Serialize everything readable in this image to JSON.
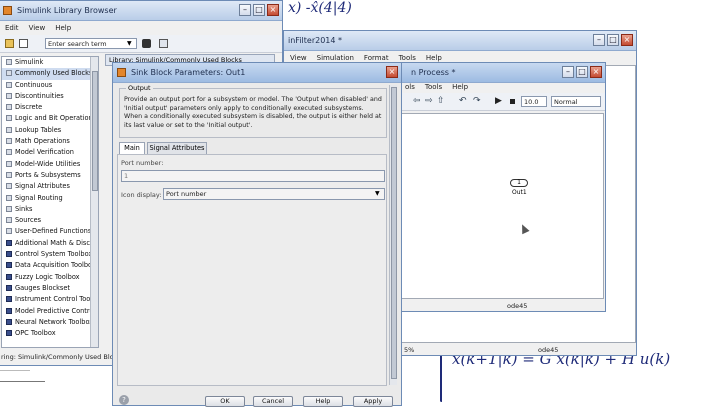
{
  "library": {
    "title": "Simulink Library Browser",
    "menu": [
      "Edit",
      "View",
      "Help"
    ],
    "search_placeholder": "Enter search term",
    "tab_label": "Library: Simulink/Commonly Used Blocks",
    "items": [
      "Simulink",
      "Commonly Used Blocks",
      "Continuous",
      "Discontinuities",
      "Discrete",
      "Logic and Bit Operations",
      "Lookup Tables",
      "Math Operations",
      "Model Verification",
      "Model-Wide Utilities",
      "Ports & Subsystems",
      "Signal Attributes",
      "Signal Routing",
      "Sinks",
      "Sources",
      "User-Defined Functions",
      "Additional Math & Discrete",
      "Control System Toolbox",
      "Data Acquisition Toolbox",
      "Fuzzy Logic Toolbox",
      "Gauges Blockset",
      "Instrument Control Toolbox",
      "Model Predictive Control ...",
      "Neural Network Toolbox",
      "OPC Toolbox"
    ],
    "status": "ring: Simulink/Commonly Used Blocks"
  },
  "model_back": {
    "title": "inFilter2014 *",
    "menu": [
      "View",
      "Simulation",
      "Format",
      "Tools",
      "Help"
    ],
    "status_zoom": "5%",
    "status_solver": "ode45"
  },
  "model_front": {
    "title": "n Process *",
    "menu": [
      "ols",
      "Tools",
      "Help"
    ],
    "stop_time": "10.0",
    "sim_mode": "Normal",
    "block_number": "1",
    "block_label": "Out1",
    "status_solver": "ode45"
  },
  "dialog": {
    "title": "Sink Block Parameters: Out1",
    "group_label": "Output",
    "description": "Provide an output port for a subsystem or model. The 'Output when disabled' and 'Initial output' parameters only apply to conditionally executed subsystems. When a conditionally executed subsystem is disabled, the output is either held at its last value or set to the 'Initial output'.",
    "tabs": [
      "Main",
      "Signal Attributes"
    ],
    "port_number_label": "Port number:",
    "port_number_value": "1",
    "icon_display_label": "Icon display:",
    "icon_display_value": "Port number",
    "buttons": {
      "ok": "OK",
      "cancel": "Cancel",
      "help": "Help",
      "apply": "Apply"
    }
  },
  "notes": {
    "top": "x) -x̂(4|4)",
    "bottom": "x̂(k+1|k) = G x(k|k) + H u(k)"
  },
  "colors": {
    "titlebar": "#b9cde8",
    "handwriting": "#1e2a78",
    "close": "#c44b32"
  }
}
